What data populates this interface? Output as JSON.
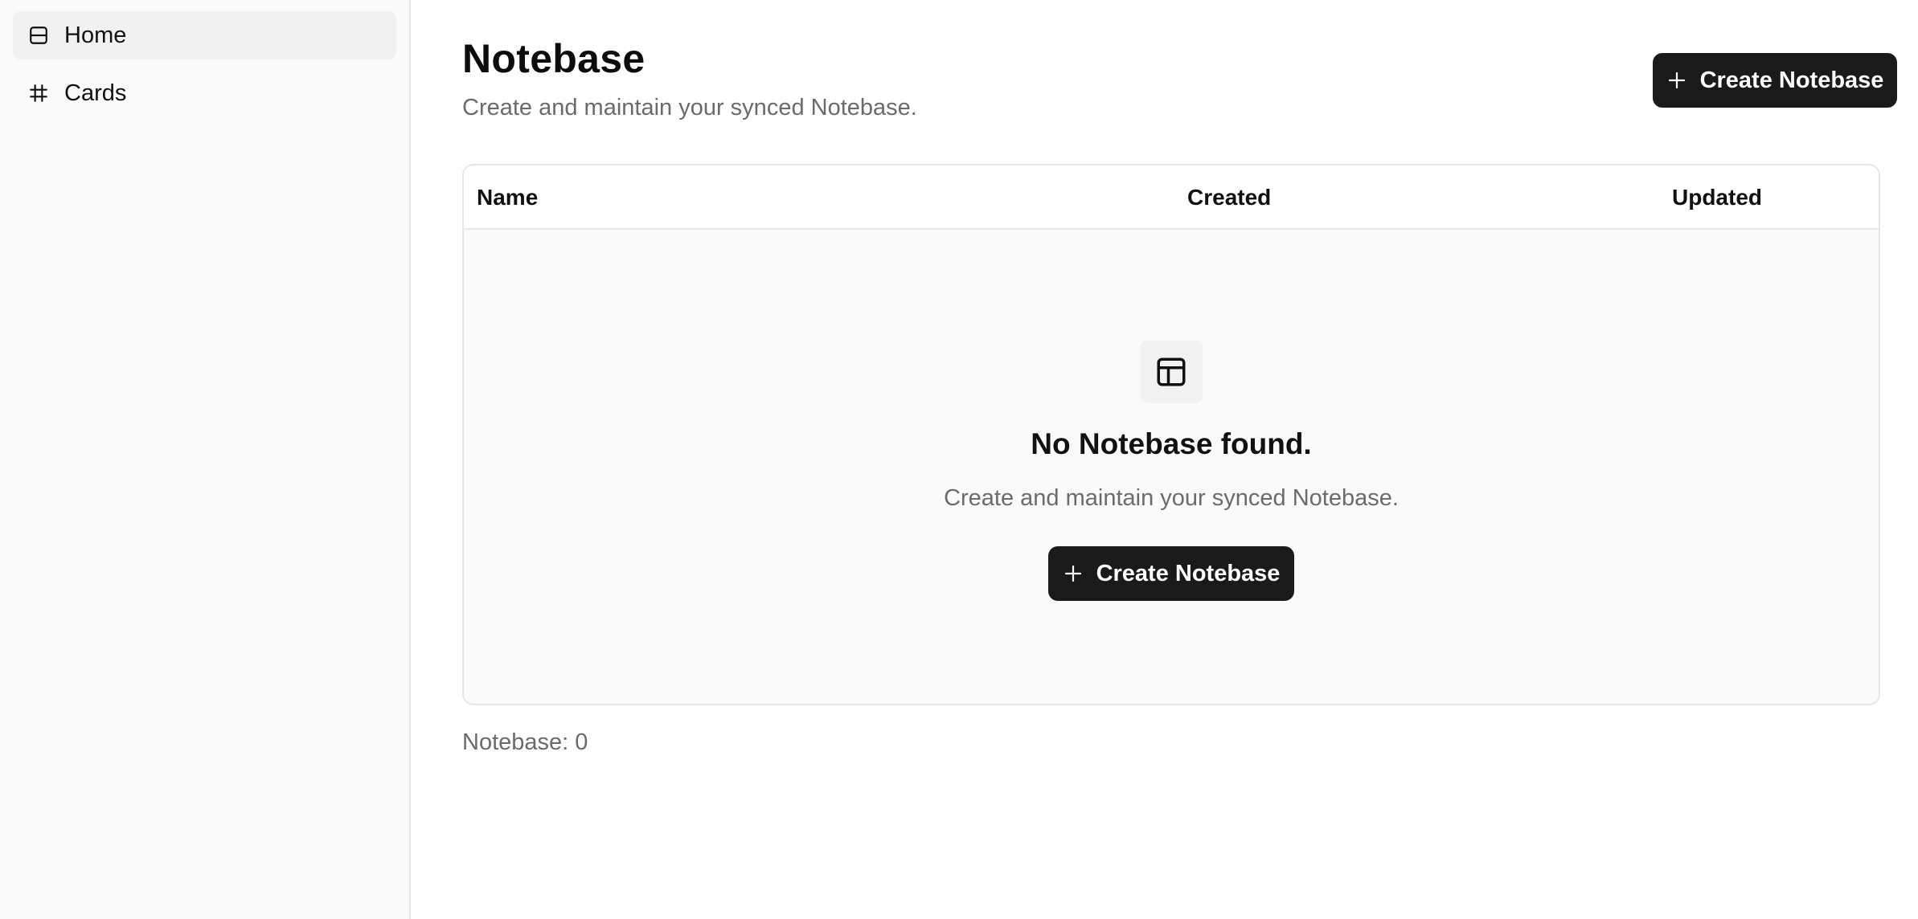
{
  "sidebar": {
    "items": [
      {
        "label": "Home",
        "icon": "layout-rows-icon",
        "active": true
      },
      {
        "label": "Cards",
        "icon": "hash-icon",
        "active": false
      }
    ]
  },
  "header": {
    "title": "Notebase",
    "subtitle": "Create and maintain your synced Notebase.",
    "create_button_label": "Create Notebase"
  },
  "table": {
    "columns": [
      "Name",
      "Created",
      "Updated"
    ],
    "rows": [],
    "empty": {
      "icon": "table-icon",
      "title": "No Notebase found.",
      "description": "Create and maintain your synced Notebase.",
      "button_label": "Create Notebase"
    }
  },
  "footer": {
    "count_text": "Notebase: 0"
  },
  "colors": {
    "primary_button": "#1a1a1a",
    "sidebar_bg": "#fafafa",
    "muted_text": "#6b6b6b",
    "border": "#e6e6e6"
  }
}
